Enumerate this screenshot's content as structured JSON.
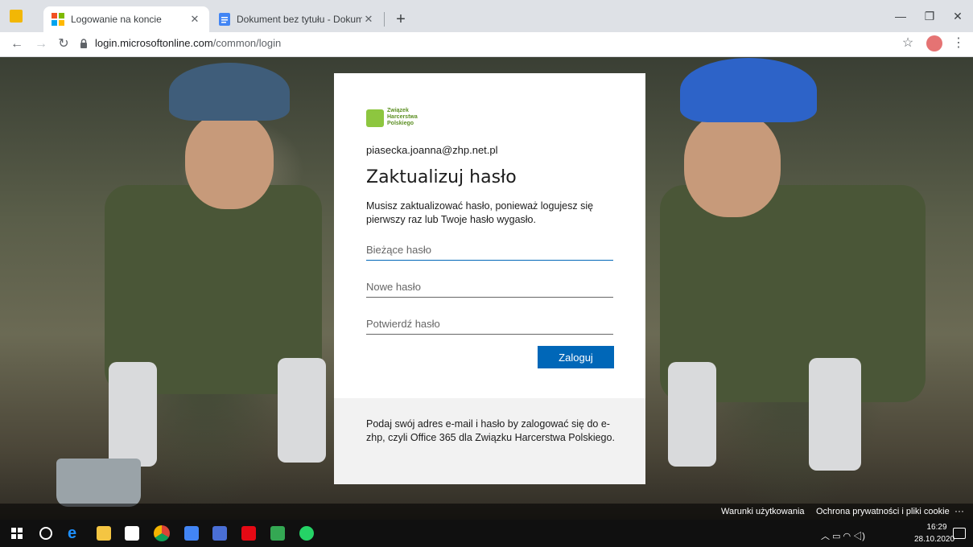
{
  "browser": {
    "tabs": [
      {
        "title": "Logowanie na koncie",
        "active": true
      },
      {
        "title": "Dokument bez tytułu - Dokumen",
        "active": false
      }
    ],
    "url_host": "login.microsoftonline.com",
    "url_path": "/common/login"
  },
  "card": {
    "logo_text": "Związek\nHarcerstwa\nPolskiego",
    "email": "piasecka.joanna@zhp.net.pl",
    "title": "Zaktualizuj hasło",
    "description": "Musisz zaktualizować hasło, ponieważ logujesz się pierwszy raz lub Twoje hasło wygasło.",
    "fields": {
      "current_password": {
        "placeholder": "Bieżące hasło",
        "value": ""
      },
      "new_password": {
        "placeholder": "Nowe hasło",
        "value": ""
      },
      "confirm_password": {
        "placeholder": "Potwierdź hasło",
        "value": ""
      }
    },
    "submit_label": "Zaloguj",
    "footer_text": "Podaj swój adres e-mail i hasło by zalogować się do e-zhp, czyli Office 365 dla Związku Harcerstwa Polskiego."
  },
  "page_footer": {
    "terms": "Warunki użytkowania",
    "privacy": "Ochrona prywatności i pliki cookie",
    "more": "···"
  },
  "taskbar": {
    "time": "16:29",
    "date": "28.10.2020"
  },
  "colors": {
    "accent": "#0067b8",
    "logo_green": "#8dc63f"
  }
}
